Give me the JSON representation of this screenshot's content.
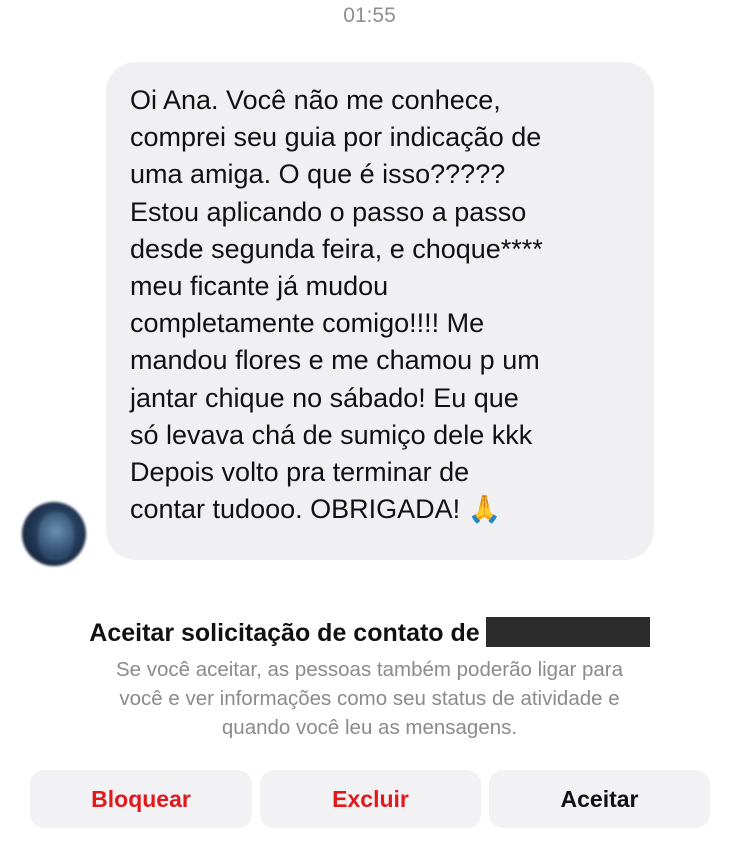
{
  "timestamp": "01:55",
  "message": {
    "text": "Oi Ana. Você não me conhece,\ncomprei seu guia por indicação de\numa amiga. O que é isso?????\nEstou aplicando o passo a passo\ndesde segunda feira, e choque****\nmeu ficante já mudou\ncompletamente comigo!!!! Me\nmandou flores e me chamou p um\njantar chique no sábado! Eu que\nsó levava chá de sumiço dele kkk\nDepois volto pra terminar de\ncontar tudooo. OBRIGADA! ",
    "emoji": "🙏"
  },
  "request": {
    "title": "Aceitar solicitação de contato de",
    "description": "Se você aceitar, as pessoas também poderão ligar para\nvocê e ver informações como seu status de atividade e\nquando você leu as mensagens."
  },
  "buttons": {
    "block": "Bloquear",
    "delete": "Excluir",
    "accept": "Aceitar"
  },
  "colors": {
    "danger": "#e0191d",
    "bubble": "#f0f0f2",
    "button_bg": "#f2f2f4",
    "muted_text": "#8a8a8f"
  }
}
